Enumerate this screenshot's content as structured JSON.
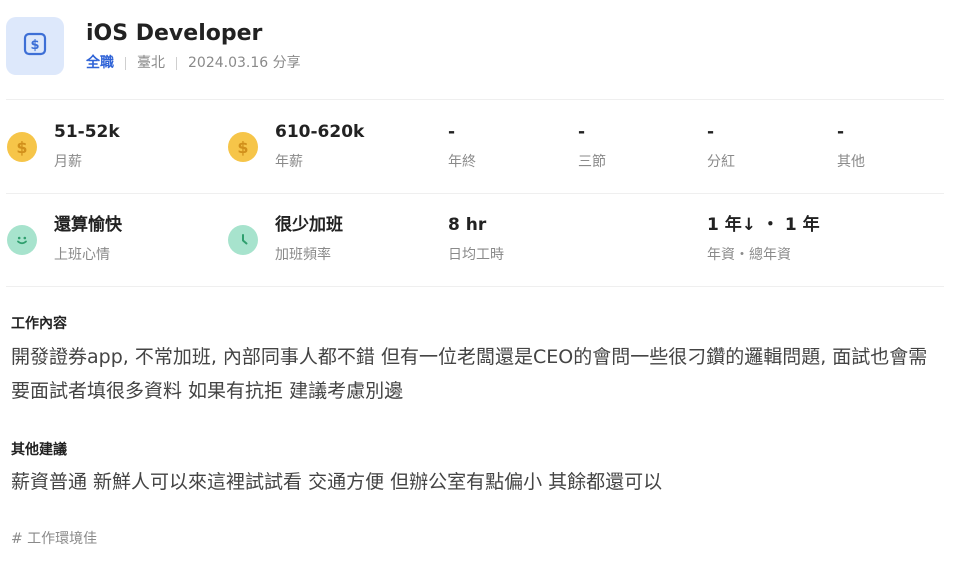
{
  "header": {
    "logo_icon": "dollar-icon",
    "title": "iOS Developer",
    "type": "全職",
    "location": "臺北",
    "shared": "2024.03.16 分享"
  },
  "stats_row1": {
    "monthly": {
      "value": "51-52k",
      "label": "月薪",
      "icon": "dollar-coin-icon"
    },
    "yearly": {
      "value": "610-620k",
      "label": "年薪",
      "icon": "dollar-coin-icon"
    },
    "bonus": {
      "value": "-",
      "label": "年終"
    },
    "festival": {
      "value": "-",
      "label": "三節"
    },
    "dividend": {
      "value": "-",
      "label": "分紅"
    },
    "other": {
      "value": "-",
      "label": "其他"
    }
  },
  "stats_row2": {
    "mood": {
      "value": "還算愉快",
      "label": "上班心情",
      "icon": "smiley-icon"
    },
    "overtime": {
      "value": "很少加班",
      "label": "加班頻率",
      "icon": "clock-icon"
    },
    "hours": {
      "value": "8 hr",
      "label": "日均工時"
    },
    "seniority": {
      "value": "1 年↓ ・ 1 年",
      "label": "年資・總年資"
    }
  },
  "content": {
    "title": "工作內容",
    "body": "開發證券app, 不常加班, 內部同事人都不錯 但有一位老闆還是CEO的會問一些很刁鑽的邏輯問題, 面試也會需要面試者填很多資料 如果有抗拒 建議考慮別邊"
  },
  "advice": {
    "title": "其他建議",
    "body": "薪資普通 新鮮人可以來這裡試試看 交通方便 但辦公室有點偏小 其餘都還可以"
  },
  "tag": "# 工作環境佳",
  "colors": {
    "accent": "#2f63d7",
    "gold": "#f6c549",
    "green": "#a7e3cd"
  }
}
